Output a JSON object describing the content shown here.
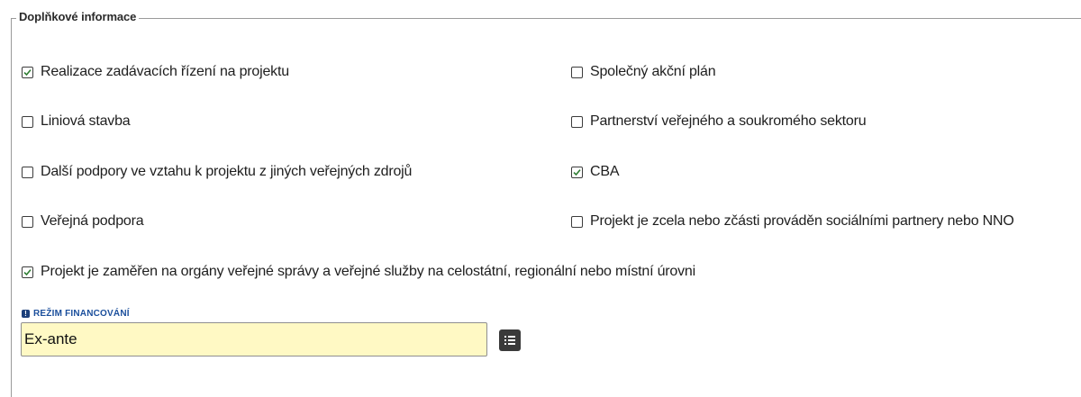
{
  "section": {
    "legend": "Doplňkové informace"
  },
  "checkboxes": [
    {
      "label": "Realizace zadávacích řízení na projektu",
      "checked": true
    },
    {
      "label": "Společný akční plán",
      "checked": false
    },
    {
      "label": "Liniová stavba",
      "checked": false
    },
    {
      "label": "Partnerství veřejného a soukromého sektoru",
      "checked": false
    },
    {
      "label": "Další podpory ve vztahu k projektu z jiných veřejných zdrojů",
      "checked": false
    },
    {
      "label": "CBA",
      "checked": true
    },
    {
      "label": "Veřejná podpora",
      "checked": false
    },
    {
      "label": "Projekt je zcela nebo zčásti prováděn sociálními partnery nebo NNO",
      "checked": false
    },
    {
      "label": "Projekt je zaměřen na orgány veřejné správy a veřejné služby na celostátní, regionální nebo místní úrovni",
      "checked": true
    }
  ],
  "financing": {
    "label": "REŽIM FINANCOVÁNÍ",
    "value": "Ex-ante",
    "required_icon": "exclamation-icon",
    "picker_icon": "list-icon"
  },
  "colors": {
    "input_bg": "#fff9c4",
    "label_blue": "#1b4f9c",
    "tick": "#2e7d32"
  }
}
